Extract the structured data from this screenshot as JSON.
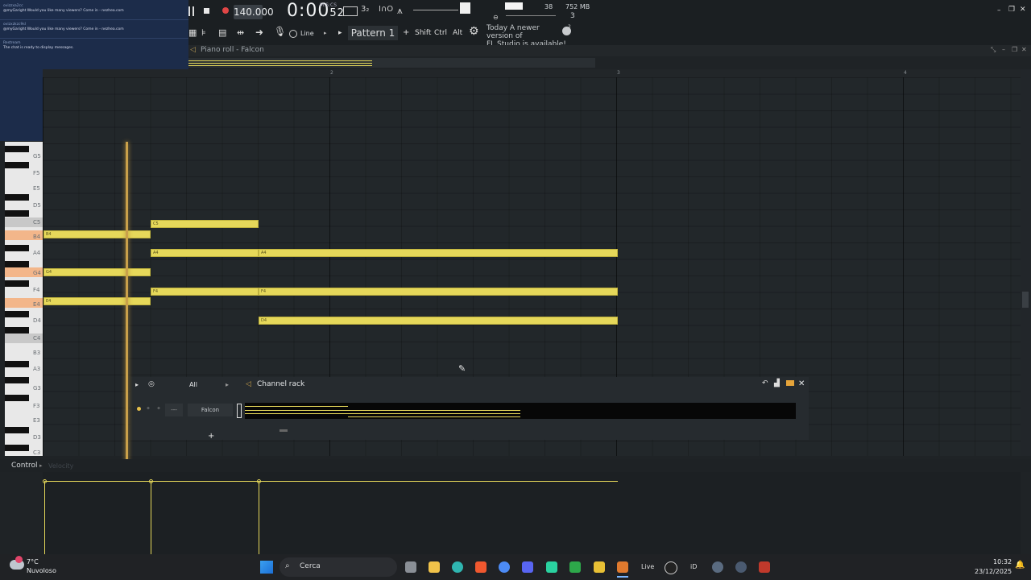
{
  "toolbar": {
    "tempo": "140.000",
    "time": "0:00",
    "time_small": "52",
    "time_label": "M:S:CS",
    "snap": "Line",
    "pattern": "Pattern 1",
    "keys": [
      "Shift",
      "Ctrl",
      "Alt"
    ],
    "news_line1": "Today  A newer version of",
    "news_line2": "FL Studio is available!",
    "cpu": "38",
    "memory": "752 MB",
    "voices": "3",
    "hint_number": "2",
    "accent": "#e6d85a"
  },
  "chat": {
    "messages": [
      {
        "user": "ovizzxa2cc",
        "text": "@myGaright Would you like many viewers? Come in - nezhea.com"
      },
      {
        "user": "ovizxzkzc9sl",
        "text": "@myGaright Would you like many viewers? Come in - nezhea.com"
      },
      {
        "user": "Restream",
        "text": "The chat is ready to display messages."
      }
    ]
  },
  "piano_roll": {
    "title": "Piano roll - Falcon",
    "bars": [
      "2",
      "3",
      "4"
    ],
    "key_labels": [
      "G5",
      "F5",
      "E5",
      "D5",
      "C5",
      "B4",
      "A4",
      "G4",
      "F4",
      "E4",
      "D4",
      "C4",
      "B3",
      "A3",
      "G3",
      "F3",
      "E3",
      "D3",
      "C3"
    ],
    "notes": [
      {
        "label": "C5"
      },
      {
        "label": "B4"
      },
      {
        "label": "A4"
      },
      {
        "label": "A4"
      },
      {
        "label": "G4"
      },
      {
        "label": "F4"
      },
      {
        "label": "F4"
      },
      {
        "label": "E4"
      },
      {
        "label": "D4"
      }
    ]
  },
  "channel_rack": {
    "title": "Channel rack",
    "filter": "All",
    "channel_name": "Falcon",
    "add_label": "+"
  },
  "control": {
    "label": "Control",
    "parameter": "Velocity"
  },
  "taskbar": {
    "temperature": "7°C",
    "weather": "Nuvoloso",
    "search_placeholder": "Cerca",
    "live_label": "Live",
    "id_label": "iD",
    "time": "10:32",
    "date": "23/12/2025"
  }
}
